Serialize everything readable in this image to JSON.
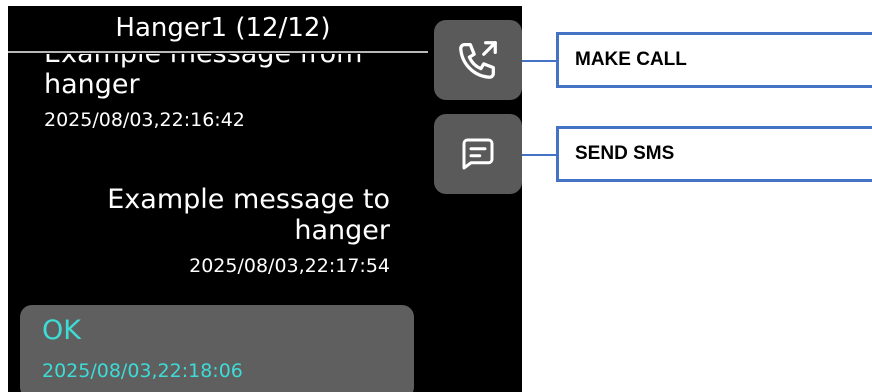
{
  "header": {
    "title": "Hanger1 (12/12)"
  },
  "messages": [
    {
      "direction": "incoming",
      "text": "Example message from hanger",
      "timestamp": "2025/08/03,22:16:42"
    },
    {
      "direction": "outgoing",
      "text": "Example message to hanger",
      "timestamp": "2025/08/03,22:17:54"
    },
    {
      "direction": "incoming",
      "text": "OK",
      "timestamp": "2025/08/03,22:18:06",
      "highlighted": true
    }
  ],
  "actions": {
    "call": {
      "icon": "phone-outgoing-icon"
    },
    "sms": {
      "icon": "message-icon"
    }
  },
  "callouts": {
    "call_label": "MAKE CALL",
    "sms_label": "SEND SMS"
  },
  "colors": {
    "screen_background": "#000000",
    "button_background": "#5a5a5a",
    "highlight_bubble": "#5f5f5f",
    "highlight_text": "#3ddcd6",
    "callout_border": "#4472c4"
  }
}
